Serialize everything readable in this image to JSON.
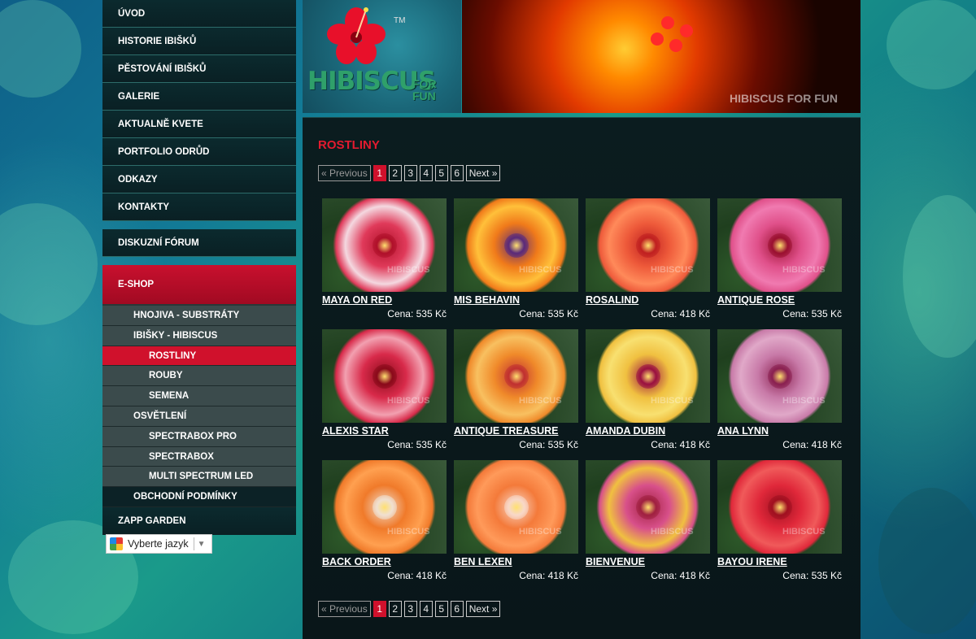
{
  "nav": {
    "main_items": [
      "ÚVOD",
      "HISTORIE IBIŠKŮ",
      "PĚSTOVÁNÍ IBIŠKŮ",
      "GALERIE",
      "AKTUALNĚ KVETE",
      "PORTFOLIO ODRŮD",
      "ODKAZY",
      "KONTAKTY"
    ],
    "forum": "DISKUZNÍ FÓRUM",
    "eshop": "E-SHOP",
    "sub_items": [
      {
        "label": "HNOJIVA - SUBSTRÁTY",
        "level": 1
      },
      {
        "label": "IBIŠKY - HIBISCUS",
        "level": 1
      },
      {
        "label": "ROSTLINY",
        "level": 2,
        "active": true
      },
      {
        "label": "ROUBY",
        "level": 2
      },
      {
        "label": "SEMENA",
        "level": 2
      },
      {
        "label": "OSVĚTLENÍ",
        "level": 1
      },
      {
        "label": "SPECTRABOX PRO",
        "level": 2
      },
      {
        "label": "SPECTRABOX",
        "level": 2
      },
      {
        "label": "MULTI SPECTRUM LED",
        "level": 2
      },
      {
        "label": "OBCHODNÍ PODMÍNKY",
        "level": 1
      }
    ],
    "zapp": "ZAPP GARDEN"
  },
  "language": {
    "label": "Vyberte jazyk",
    "arrow": "▼"
  },
  "header": {
    "logo_text": "HIBISCUS",
    "logo_for": "FOR FUN",
    "logo_tm": "TM",
    "banner_watermark": "HIBISCUS FOR FUN"
  },
  "main": {
    "title": "ROSTLINY",
    "pager": {
      "prev": "« Previous",
      "pages": [
        "1",
        "2",
        "3",
        "4",
        "5",
        "6"
      ],
      "current": "1",
      "next": "Next »"
    },
    "watermark": "HIBISCUS",
    "products": [
      {
        "name": "MAYA ON RED",
        "price": "Cena: 535 Kč",
        "petal": "#e03a5a",
        "edge": "#f4d8e0",
        "eye": "#b0102a"
      },
      {
        "name": "MIS BEHAVIN",
        "price": "Cena: 535 Kč",
        "petal": "#f07a1a",
        "edge": "#ffc03a",
        "eye": "#5a2a7a"
      },
      {
        "name": "ROSALIND",
        "price": "Cena: 418 Kč",
        "petal": "#ee5a3a",
        "edge": "#ff8a5a",
        "eye": "#c02020"
      },
      {
        "name": "ANTIQUE ROSE",
        "price": "Cena: 535 Kč",
        "petal": "#e0508a",
        "edge": "#f07ab0",
        "eye": "#9a1030"
      },
      {
        "name": "ALEXIS STAR",
        "price": "Cena: 535 Kč",
        "petal": "#d82a4a",
        "edge": "#f2a0b0",
        "eye": "#8a0a1a"
      },
      {
        "name": "ANTIQUE TREASURE",
        "price": "Cena: 535 Kč",
        "petal": "#f08a2a",
        "edge": "#f8c060",
        "eye": "#c03030"
      },
      {
        "name": "AMANDA DUBIN",
        "price": "Cena: 418 Kč",
        "petal": "#f0c040",
        "edge": "#f8e070",
        "eye": "#9a1040"
      },
      {
        "name": "ANA LYNN",
        "price": "Cena: 418 Kč",
        "petal": "#c87aa8",
        "edge": "#e0a8c8",
        "eye": "#8a2050"
      },
      {
        "name": "BACK ORDER",
        "price": "Cena: 418 Kč",
        "petal": "#f07a2a",
        "edge": "#ffa050",
        "eye": "#f0e0d0"
      },
      {
        "name": "BEN LEXEN",
        "price": "Cena: 418 Kč",
        "petal": "#f47a3a",
        "edge": "#ff9a5a",
        "eye": "#f8d8c8"
      },
      {
        "name": "BIENVENUE",
        "price": "Cena: 418 Kč",
        "petal": "#d8508a",
        "edge": "#f0c040",
        "eye": "#a02040"
      },
      {
        "name": "BAYOU IRENE",
        "price": "Cena: 535 Kč",
        "petal": "#e0283a",
        "edge": "#f05a5a",
        "eye": "#a01020"
      }
    ]
  },
  "colors": {
    "accent_red": "#d0112c",
    "title_red": "#e31b2f",
    "nav_dark": "#0b2a2e",
    "sub_grey": "#3b4b4c"
  }
}
